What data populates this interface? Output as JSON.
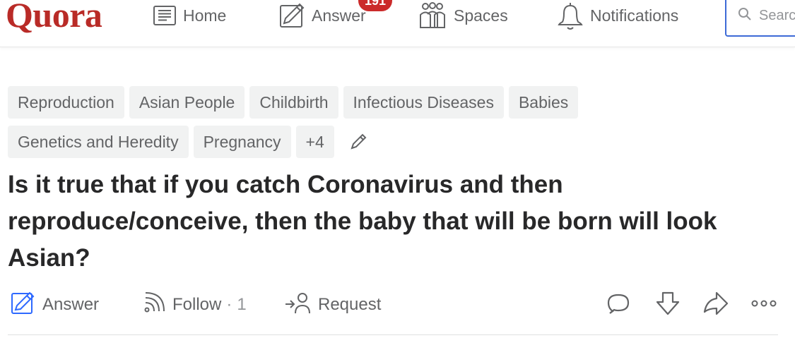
{
  "header": {
    "logo": "Quora",
    "nav": [
      {
        "label": "Home",
        "icon": "home-icon"
      },
      {
        "label": "Answer",
        "icon": "answer-pencil-icon",
        "badge": "191"
      },
      {
        "label": "Spaces",
        "icon": "spaces-people-icon"
      },
      {
        "label": "Notifications",
        "icon": "bell-icon"
      }
    ],
    "search_placeholder": "Search Quora"
  },
  "topics": {
    "row1": [
      "Reproduction",
      "Asian People",
      "Childbirth",
      "Infectious Diseases",
      "Babies"
    ],
    "row2": [
      "Genetics and Heredity",
      "Pregnancy",
      "+4"
    ]
  },
  "question": {
    "title": "Is it true that if you catch Coronavirus and then reproduce/conceive, then the baby that will be born will look Asian?"
  },
  "actions": {
    "answer_label": "Answer",
    "follow_label": "Follow",
    "follow_separator": "·",
    "follow_count": "1",
    "request_label": "Request",
    "icons": [
      "comment-icon",
      "downvote-icon",
      "share-icon",
      "more-icon"
    ]
  },
  "colors": {
    "brand": "#b92b27",
    "badge": "#cb2a2a",
    "answer_accent": "#2e69ff",
    "text": "#282829",
    "muted": "#636466",
    "topic_bg": "#f1f2f2",
    "search_border": "#3d6ad6"
  }
}
